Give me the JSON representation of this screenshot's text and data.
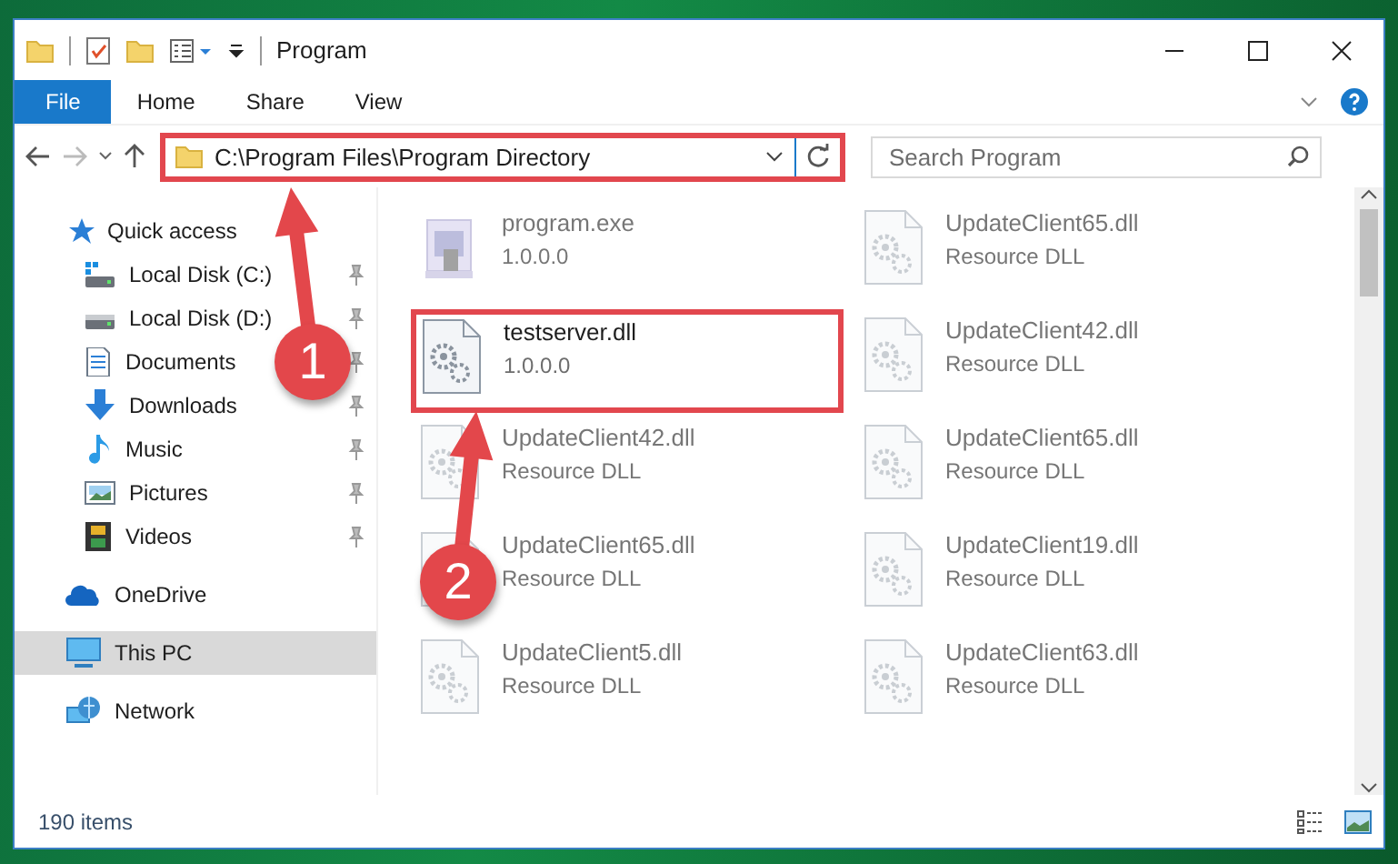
{
  "window": {
    "title": "Program"
  },
  "ribbon_tabs": [
    {
      "label": "File",
      "kind": "file"
    },
    {
      "label": "Home",
      "kind": "tab"
    },
    {
      "label": "Share",
      "kind": "tab"
    },
    {
      "label": "View",
      "kind": "tab"
    }
  ],
  "address_bar": {
    "path": "C:\\Program Files\\Program Directory",
    "highlighted": true
  },
  "search": {
    "placeholder": "Search Program"
  },
  "sidebar": {
    "items": [
      {
        "label": "Quick access",
        "kind": "star",
        "selected": false,
        "children": [
          {
            "label": "Local Disk (C:)",
            "kind": "system-drive",
            "pinned": true,
            "selected": false
          },
          {
            "label": "Local Disk (D:)",
            "kind": "drive",
            "pinned": true,
            "selected": false
          },
          {
            "label": "Documents",
            "kind": "documents",
            "pinned": true,
            "selected": false
          },
          {
            "label": "Downloads",
            "kind": "downloads",
            "pinned": true,
            "selected": false
          },
          {
            "label": "Music",
            "kind": "music",
            "pinned": true,
            "selected": false
          },
          {
            "label": "Pictures",
            "kind": "pictures",
            "pinned": true,
            "selected": false
          },
          {
            "label": "Videos",
            "kind": "videos",
            "pinned": true,
            "selected": false
          }
        ]
      },
      {
        "label": "OneDrive",
        "kind": "cloud",
        "selected": false
      },
      {
        "label": "This PC",
        "kind": "pc",
        "selected": true
      },
      {
        "label": "Network",
        "kind": "network",
        "selected": false
      }
    ]
  },
  "files": [
    {
      "name": "program.exe",
      "detail": "1.0.0.0",
      "kind": "exe",
      "blurred": true,
      "highlighted": false
    },
    {
      "name": "UpdateClient65.dll",
      "detail": "Resource DLL",
      "kind": "dll",
      "blurred": true,
      "highlighted": false
    },
    {
      "name": "testserver.dll",
      "detail": "1.0.0.0",
      "kind": "dll",
      "blurred": false,
      "highlighted": true
    },
    {
      "name": "UpdateClient42.dll",
      "detail": "Resource DLL",
      "kind": "dll",
      "blurred": true,
      "highlighted": false
    },
    {
      "name": "UpdateClient42.dll",
      "detail": "Resource DLL",
      "kind": "dll",
      "blurred": true,
      "highlighted": false
    },
    {
      "name": "UpdateClient65.dll",
      "detail": "Resource DLL",
      "kind": "dll",
      "blurred": true,
      "highlighted": false
    },
    {
      "name": "UpdateClient65.dll",
      "detail": "Resource DLL",
      "kind": "dll",
      "blurred": true,
      "highlighted": false
    },
    {
      "name": "UpdateClient19.dll",
      "detail": "Resource DLL",
      "kind": "dll",
      "blurred": true,
      "highlighted": false
    },
    {
      "name": "UpdateClient5.dll",
      "detail": "Resource DLL",
      "kind": "dll",
      "blurred": true,
      "highlighted": false
    },
    {
      "name": "UpdateClient63.dll",
      "detail": "Resource DLL",
      "kind": "dll",
      "blurred": true,
      "highlighted": false
    }
  ],
  "status_bar": {
    "item_count": "190 items"
  },
  "annotations": [
    {
      "label": "1"
    },
    {
      "label": "2"
    }
  ]
}
